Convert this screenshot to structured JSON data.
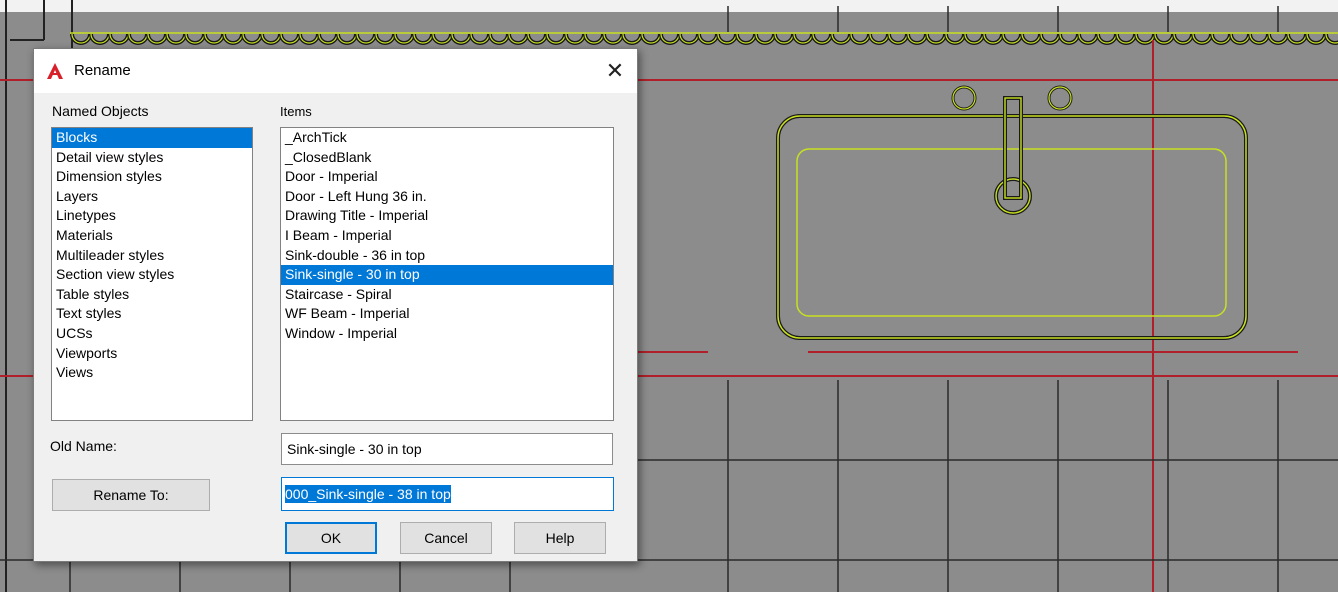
{
  "dialog": {
    "title": "Rename",
    "close_glyph": "✕",
    "app_icon": "autocad-icon",
    "named_objects_label": "Named Objects",
    "items_label": "Items",
    "named_objects": [
      "Blocks",
      "Detail view styles",
      "Dimension styles",
      "Layers",
      "Linetypes",
      "Materials",
      "Multileader styles",
      "Section view styles",
      "Table styles",
      "Text styles",
      "UCSs",
      "Viewports",
      "Views"
    ],
    "named_objects_selected": "Blocks",
    "items": [
      "_ArchTick",
      "_ClosedBlank",
      "Door - Imperial",
      "Door - Left Hung 36 in.",
      "Drawing Title - Imperial",
      "I Beam - Imperial",
      "Sink-double - 36 in top",
      "Sink-single - 30 in top",
      "Staircase - Spiral",
      "WF Beam - Imperial",
      "Window - Imperial"
    ],
    "items_selected": "Sink-single - 30 in top",
    "old_name_label": "Old Name:",
    "old_name_value": "Sink-single - 30 in top",
    "rename_to_label": "Rename To:",
    "rename_to_value": "000_Sink-single - 38 in top",
    "ok_label": "OK",
    "cancel_label": "Cancel",
    "help_label": "Help"
  },
  "colors": {
    "cad_background": "#8c8c8c",
    "grid_line": "#2a2a2a",
    "red_axis": "#b0202a",
    "sink_outline": "#c8e020",
    "selection": "#0078d7",
    "autocad_red": "#d8202a"
  }
}
